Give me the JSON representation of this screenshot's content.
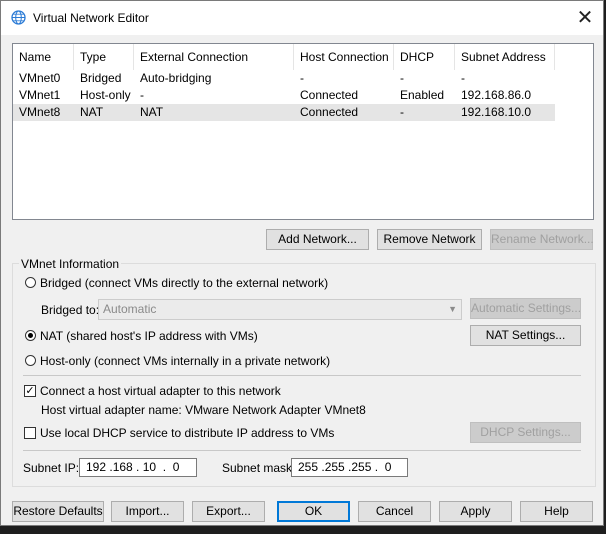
{
  "window": {
    "title": "Virtual Network Editor",
    "close_symbol": "✕"
  },
  "table": {
    "columns": [
      "Name",
      "Type",
      "External Connection",
      "Host Connection",
      "DHCP",
      "Subnet Address"
    ],
    "rows": [
      {
        "name": "VMnet0",
        "type": "Bridged",
        "external": "Auto-bridging",
        "host": "-",
        "dhcp": "-",
        "subnet": "-"
      },
      {
        "name": "VMnet1",
        "type": "Host-only",
        "external": "-",
        "host": "Connected",
        "dhcp": "Enabled",
        "subnet": "192.168.86.0"
      },
      {
        "name": "VMnet8",
        "type": "NAT",
        "external": "NAT",
        "host": "Connected",
        "dhcp": "-",
        "subnet": "192.168.10.0",
        "selected": true
      }
    ]
  },
  "list_buttons": {
    "add": "Add Network...",
    "remove": "Remove Network",
    "rename": "Rename Network..."
  },
  "vmnet_info": {
    "group_label": "VMnet Information",
    "bridged_radio": "Bridged (connect VMs directly to the external network)",
    "bridged_to_label": "Bridged to:",
    "bridged_to_value": "Automatic",
    "auto_settings": "Automatic Settings...",
    "nat_radio": "NAT (shared host's IP address with VMs)",
    "nat_settings": "NAT Settings...",
    "hostonly_radio": "Host-only (connect VMs internally in a private network)",
    "selected_mode": "nat",
    "connect_adapter": "Connect a host virtual adapter to this network",
    "connect_adapter_checked": true,
    "adapter_name_text": "Host virtual adapter name: VMware Network Adapter VMnet8",
    "dhcp_check": "Use local DHCP service to distribute IP address to VMs",
    "dhcp_checked": false,
    "dhcp_settings": "DHCP Settings...",
    "subnet_ip_label": "Subnet IP:",
    "subnet_ip": "192 .168 . 10  .  0",
    "subnet_mask_label": "Subnet mask:",
    "subnet_mask": "255 .255 .255 .  0"
  },
  "bottom_buttons": {
    "restore": "Restore Defaults",
    "import": "Import...",
    "export": "Export...",
    "ok": "OK",
    "cancel": "Cancel",
    "apply": "Apply",
    "help": "Help"
  },
  "colors": {
    "accent": "#0078d7",
    "selection": "#e5e5e5",
    "window_bg": "#f0f0f0"
  }
}
